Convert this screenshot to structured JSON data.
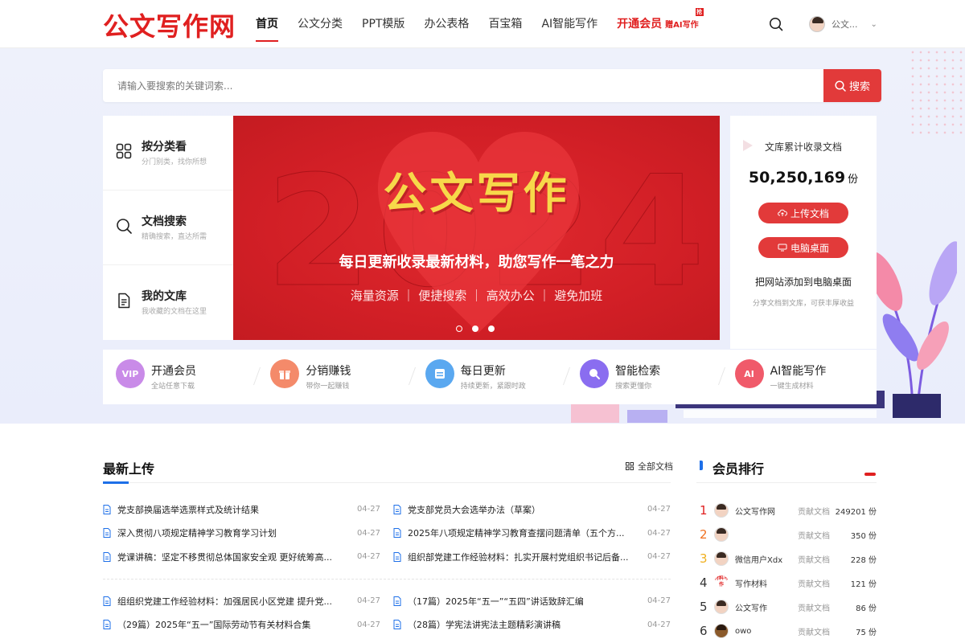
{
  "header": {
    "logo": "公文写作网",
    "nav": [
      {
        "label": "首页",
        "active": true
      },
      {
        "label": "公文分类"
      },
      {
        "label": "PPT模版"
      },
      {
        "label": "办公表格"
      },
      {
        "label": "百宝箱"
      },
      {
        "label": "AI智能写作"
      }
    ],
    "vip_label": "开通会员",
    "vip_sub": "赠AI写作",
    "vip_badge": "抢",
    "user_name": "公文..."
  },
  "search": {
    "placeholder": "请输入要搜索的关键词索...",
    "button_label": "搜索"
  },
  "quick_menu": [
    {
      "title": "按分类看",
      "sub": "分门别类，找你所想",
      "icon": "grid-icon"
    },
    {
      "title": "文档搜索",
      "sub": "精确搜索，直达所需",
      "icon": "search-icon"
    },
    {
      "title": "我的文库",
      "sub": "我收藏的文档在这里",
      "icon": "document-icon"
    }
  ],
  "banner": {
    "year": "2024",
    "title": "公文写作",
    "subtitle": "每日更新收录最新材料，助您写作一笔之力",
    "tags": "海量资源 ｜ 便捷搜索 ｜ 高效办公 ｜ 避免加班",
    "slides": 3,
    "active_slide": 0
  },
  "stats": {
    "label": "文库累计收录文档",
    "count": "50,250,169",
    "unit": "份",
    "upload_label": "上传文档",
    "desktop_label": "电脑桌面",
    "add_desktop": "把网站添加到电脑桌面",
    "desc": "分享文档到文库，可获丰厚收益"
  },
  "features": [
    {
      "title": "开通会员",
      "sub": "全站任意下载",
      "icon": "vip-icon",
      "icon_text": "VIP",
      "color": "#c98be8"
    },
    {
      "title": "分销赚钱",
      "sub": "带你一起赚钱",
      "icon": "gift-icon",
      "icon_text": "",
      "color": "#f48a6a"
    },
    {
      "title": "每日更新",
      "sub": "持续更新，紧跟时政",
      "icon": "calendar-icon",
      "icon_text": "",
      "color": "#5aa8f0"
    },
    {
      "title": "智能检索",
      "sub": "搜索更懂你",
      "icon": "magnifier-icon",
      "icon_text": "",
      "color": "#8a6df0"
    },
    {
      "title": "AI智能写作",
      "sub": "一键生成材料",
      "icon": "ai-icon",
      "icon_text": "AI",
      "color": "#f05a6a"
    }
  ],
  "latest": {
    "title": "最新上传",
    "all_label": "全部文档",
    "left": [
      {
        "title": "党支部换届选举选票样式及统计结果",
        "date": "04-27"
      },
      {
        "title": "深入贯彻八项规定精神学习教育学习计划",
        "date": "04-27"
      },
      {
        "title": "党课讲稿：坚定不移贯彻总体国家安全观 更好统筹高...",
        "date": "04-27"
      },
      {
        "title": "组组织党建工作经验材料：加强居民小区党建 提升党...",
        "date": "04-27"
      },
      {
        "title": "（29篇）2025年“五一”国际劳动节有关材料合集",
        "date": "04-27"
      }
    ],
    "right": [
      {
        "title": "党支部党员大会选举办法（草案）",
        "date": "04-27"
      },
      {
        "title": "2025年八项规定精神学习教育查摆问题清单（五个方...",
        "date": "04-27"
      },
      {
        "title": "组织部党建工作经验材料：扎实开展村党组织书记后备...",
        "date": "04-27"
      },
      {
        "title": "（17篇）2025年“五一”“五四”讲话致辞汇编",
        "date": "04-27"
      },
      {
        "title": "（28篇）学宪法讲宪法主题精彩演讲稿",
        "date": "04-27"
      }
    ]
  },
  "ranking": {
    "title": "会员排行",
    "rows": [
      {
        "rank": "1",
        "name": "公文写作网",
        "label": "贡献文档",
        "value": "249201 份",
        "rank_color": "#e02020",
        "avatar": "face"
      },
      {
        "rank": "2",
        "name": "",
        "label": "贡献文档",
        "value": "350 份",
        "rank_color": "#f07020",
        "avatar": "face"
      },
      {
        "rank": "3",
        "name": "微信用户Xdx",
        "label": "贡献文档",
        "value": "228 份",
        "rank_color": "#f0b020",
        "avatar": "face"
      },
      {
        "rank": "4",
        "name": "写作材料",
        "label": "贡献文档",
        "value": "121 份",
        "rank_color": "#333333",
        "avatar": "text",
        "avatar_text": "材料写作"
      },
      {
        "rank": "5",
        "name": "公文写作",
        "label": "贡献文档",
        "value": "86 份",
        "rank_color": "#333333",
        "avatar": "face"
      },
      {
        "rank": "6",
        "name": "owo",
        "label": "贡献文档",
        "value": "75 份",
        "rank_color": "#333333",
        "avatar": "dark"
      }
    ]
  },
  "colors": {
    "brand": "#e02020",
    "accent_blue": "#1d6fe8",
    "button": "#e23a3a"
  }
}
